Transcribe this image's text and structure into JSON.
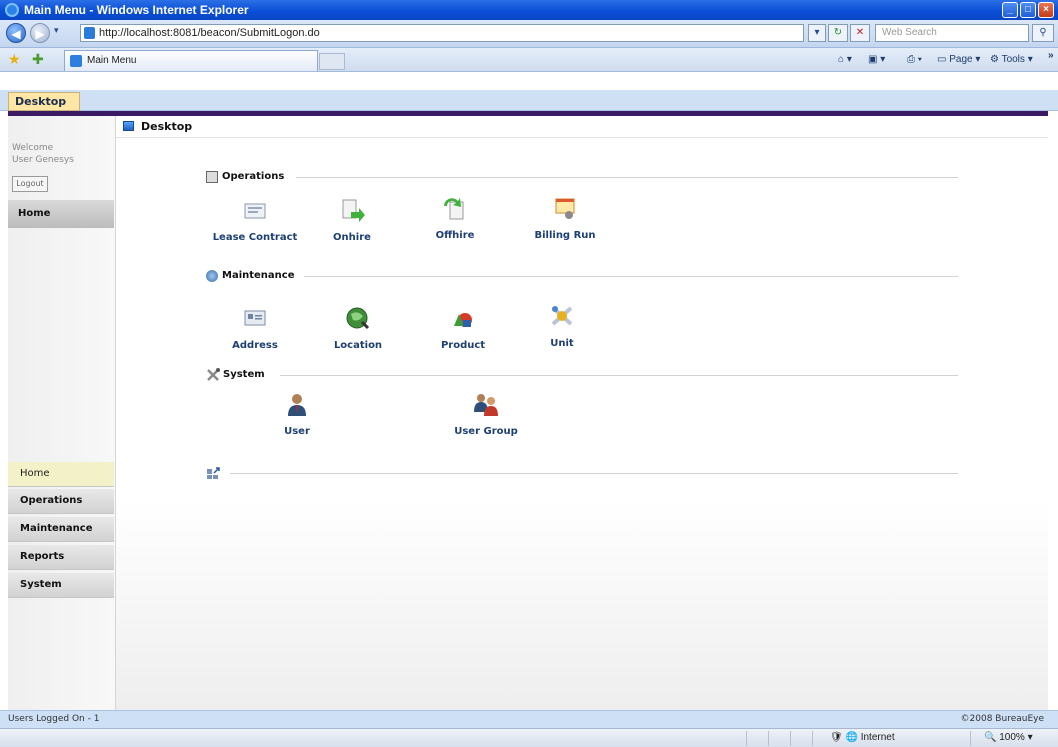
{
  "window": {
    "title": "Main Menu - Windows Internet Explorer"
  },
  "browser": {
    "url": "http://localhost:8081/beacon/SubmitLogon.do",
    "search_placeholder": "Web Search",
    "tab_title": "Main Menu",
    "page_label": "Page",
    "tools_label": "Tools"
  },
  "app": {
    "tab_label": "Desktop",
    "content_title": "Desktop",
    "welcome": "Welcome",
    "user": "User Genesys",
    "logout_label": "Logout",
    "home_label": "Home"
  },
  "nav": {
    "items": [
      {
        "label": "Home"
      },
      {
        "label": "Operations"
      },
      {
        "label": "Maintenance"
      },
      {
        "label": "Reports"
      },
      {
        "label": "System"
      }
    ]
  },
  "sections": {
    "operations": {
      "title": "Operations",
      "items": [
        {
          "label": "Lease Contract",
          "icon": "lease-contract-icon"
        },
        {
          "label": "Onhire",
          "icon": "onhire-icon"
        },
        {
          "label": "Offhire",
          "icon": "offhire-icon"
        },
        {
          "label": "Billing Run",
          "icon": "billing-run-icon"
        }
      ]
    },
    "maintenance": {
      "title": "Maintenance",
      "items": [
        {
          "label": "Address",
          "icon": "address-icon"
        },
        {
          "label": "Location",
          "icon": "location-icon"
        },
        {
          "label": "Product",
          "icon": "product-icon"
        },
        {
          "label": "Unit",
          "icon": "unit-icon"
        }
      ]
    },
    "system": {
      "title": "System",
      "items": [
        {
          "label": "User",
          "icon": "user-icon"
        },
        {
          "label": "User Group",
          "icon": "user-group-icon"
        }
      ]
    }
  },
  "status": {
    "users_logged": "Users Logged On - 1",
    "copyright": "©2008 BureauEye",
    "zone": "Internet",
    "zoom": "100%"
  }
}
